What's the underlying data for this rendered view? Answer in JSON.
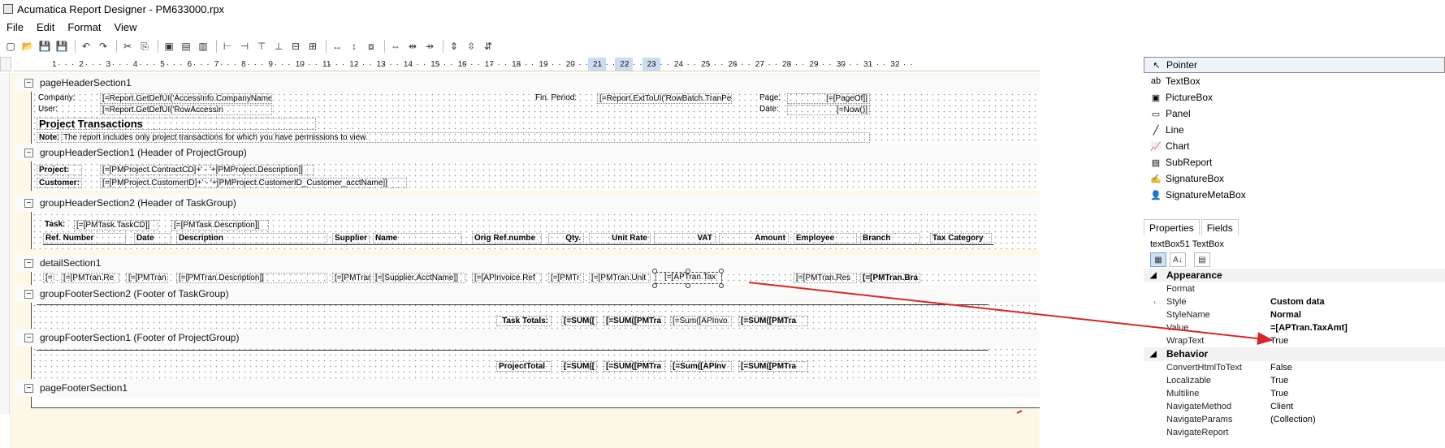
{
  "window": {
    "title": "Acumatica Report Designer - PM633000.rpx"
  },
  "menu": [
    "File",
    "Edit",
    "Format",
    "View"
  ],
  "toolbar_icons": [
    "new-icon",
    "open-icon",
    "save-icon",
    "save-as-icon",
    "undo-icon",
    "redo-icon",
    "cut-icon",
    "copy-icon",
    "bring-front-icon",
    "send-back-icon",
    "group-icon",
    "align-left-icon",
    "align-center-icon",
    "align-right-icon",
    "align-top-icon",
    "align-middle-icon",
    "align-bottom-icon",
    "same-width-icon",
    "same-height-icon",
    "same-size-icon",
    "h-spacing-equal-icon",
    "h-spacing-inc-icon",
    "h-spacing-dec-icon",
    "v-spacing-equal-icon",
    "v-spacing-inc-icon",
    "v-spacing-dec-icon"
  ],
  "ruler": {
    "labels": [
      "1",
      "2",
      "3",
      "4",
      "5",
      "6",
      "7",
      "8",
      "9",
      "10",
      "11",
      "12",
      "13",
      "14",
      "15",
      "16",
      "17",
      "18",
      "19",
      "20",
      "21",
      "22",
      "23",
      "24",
      "25",
      "26",
      "27",
      "28",
      "29",
      "30",
      "31",
      "32"
    ],
    "highlight": [
      "21",
      "22",
      "23"
    ]
  },
  "sections": {
    "pageHeader": "pageHeaderSection1",
    "groupHeader1": "groupHeaderSection1 (Header of ProjectGroup)",
    "groupHeader2": "groupHeaderSection2 (Header of TaskGroup)",
    "detail": "detailSection1",
    "groupFooter2": "groupFooterSection2 (Footer of TaskGroup)",
    "groupFooter1": "groupFooterSection1 (Footer of ProjectGroup)",
    "pageFooter": "pageFooterSection1"
  },
  "pageHeader": {
    "company_label": "Company:",
    "company_value": "[=Report.GetDefUI('AccessInfo.CompanyName'",
    "user_label": "User:",
    "user_value": "[=Report.GetDefUI('RowAccessIn",
    "title": "Project Transactions",
    "note_label": "Note:",
    "note_text": "The report includes only project transactions for which you have permissions to view.",
    "finperiod_label": "Fin. Period:",
    "finperiod_value": "[=Report.ExtToUI('RowBatch.TranPe",
    "page_label": "Page:",
    "page_value": "[=[PageOf]]",
    "date_label": "Date:",
    "date_value": "[=Now()]"
  },
  "groupHeader1": {
    "project_label": "Project:",
    "project_value": "[=[PMProject.ContractCD]+' - '+[PMProject.Description]]",
    "customer_label": "Customer:",
    "customer_value": "[=[PMProject.CustomerID]+' - '+[PMProject.CustomerID_Customer_acctName]]"
  },
  "groupHeader2": {
    "task_label": "Task:",
    "task_cd": "[=[PMTask.TaskCD]]",
    "task_desc": "[=[PMTask.Description]]",
    "columns": [
      "Ref. Number",
      "Date",
      "Description",
      "Supplier",
      "Name",
      "Orig Ref.numbe",
      "Qty.",
      "Unit Rate",
      "VAT",
      "Amount",
      "Employee",
      "Branch",
      "Tax Category"
    ]
  },
  "detail": [
    "[=",
    "[=[PMTran.Re",
    "[=[PMTran",
    "[=[PMTran.Description]]",
    "[=[PMTran",
    "[=[Supplier.AcctName]]",
    "[=[APInvoice.Ref",
    "[=[PMTr",
    "[=[PMTran.Unit",
    "[=[APTran.Tax",
    "[=[PMTran.Res",
    "[=[PMTran.Bra"
  ],
  "groupFooter2": {
    "label": "Task Totals:",
    "values": [
      "[=SUM([",
      "[=SUM([PMTra",
      "[=Sum([APInvo",
      "[=SUM([PMTra"
    ]
  },
  "groupFooter1": {
    "label": "ProjectTotal",
    "values": [
      "[=SUM([",
      "[=SUM([PMTra",
      "[=Sum([APInv",
      "[=SUM([PMTra"
    ]
  },
  "toolbox": [
    {
      "label": "Pointer",
      "icon": "pointer-icon",
      "glyph": "↖"
    },
    {
      "label": "TextBox",
      "icon": "textbox-icon",
      "glyph": "ab"
    },
    {
      "label": "PictureBox",
      "icon": "picturebox-icon",
      "glyph": "▣"
    },
    {
      "label": "Panel",
      "icon": "panel-icon",
      "glyph": "▭"
    },
    {
      "label": "Line",
      "icon": "line-icon",
      "glyph": "╱"
    },
    {
      "label": "Chart",
      "icon": "chart-icon",
      "glyph": "📈"
    },
    {
      "label": "SubReport",
      "icon": "subreport-icon",
      "glyph": "▤"
    },
    {
      "label": "SignatureBox",
      "icon": "signaturebox-icon",
      "glyph": "✍"
    },
    {
      "label": "SignatureMetaBox",
      "icon": "signaturemetabox-icon",
      "glyph": "👤"
    }
  ],
  "properties": {
    "tabs": [
      "Properties",
      "Fields"
    ],
    "object": "textBox51  TextBox",
    "categories": [
      {
        "name": "Appearance",
        "rows": [
          {
            "name": "Format",
            "value": ""
          },
          {
            "name": "Style",
            "value": "Custom data",
            "bold": true,
            "expandable": true
          },
          {
            "name": "StyleName",
            "value": "Normal",
            "bold": true
          },
          {
            "name": "Value",
            "value": "=[APTran.TaxAmt]",
            "bold": true
          },
          {
            "name": "WrapText",
            "value": "True"
          }
        ]
      },
      {
        "name": "Behavior",
        "rows": [
          {
            "name": "ConvertHtmlToText",
            "value": "False"
          },
          {
            "name": "Localizable",
            "value": "True"
          },
          {
            "name": "Multiline",
            "value": "True"
          },
          {
            "name": "NavigateMethod",
            "value": "Client"
          },
          {
            "name": "NavigateParams",
            "value": "(Collection)"
          },
          {
            "name": "NavigateReport",
            "value": ""
          }
        ]
      }
    ]
  },
  "colors": {
    "arrow": "#d9262a",
    "band_bg": "#fafafa",
    "design_bg": "#fdf8e6",
    "selection": "#cfe1f7"
  }
}
